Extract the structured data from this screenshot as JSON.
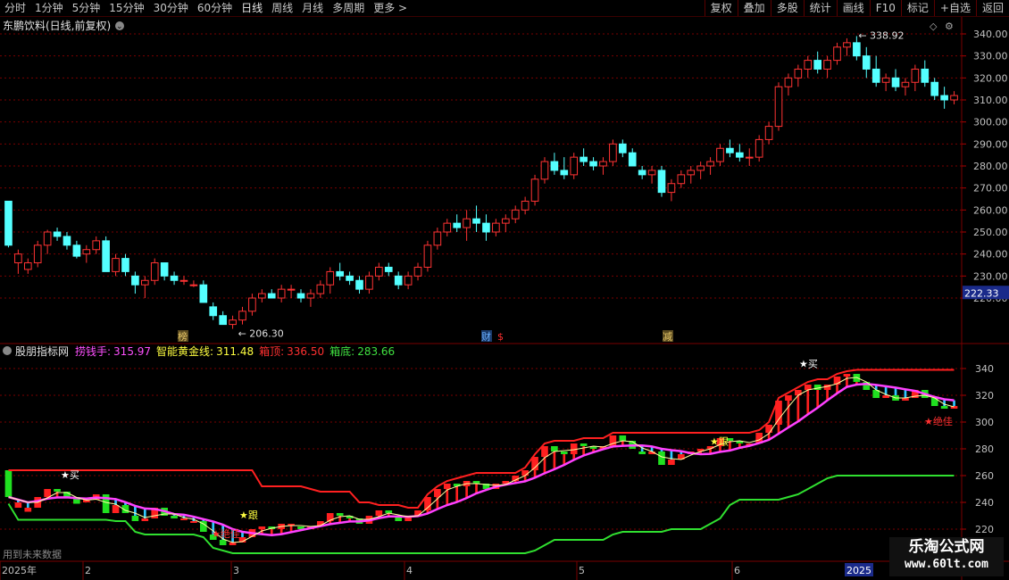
{
  "toolbar": {
    "left": [
      "分时",
      "1分钟",
      "5分钟",
      "15分钟",
      "30分钟",
      "60分钟",
      "日线",
      "周线",
      "月线",
      "多周期",
      "更多 >"
    ],
    "active": "日线",
    "right": [
      "复权",
      "叠加",
      "多股",
      "统计",
      "画线",
      "F10",
      "标记",
      "+自选",
      "返回"
    ]
  },
  "main_panel": {
    "title": "东鹏饮料(日线,前复权)",
    "high_label": "338.92",
    "low_label": "206.30",
    "price_ticks": [
      "340.00",
      "330.00",
      "320.00",
      "310.00",
      "300.00",
      "290.00",
      "280.00",
      "270.00",
      "260.00",
      "250.00",
      "240.00",
      "230.00",
      "220.00"
    ],
    "current_price": "222.33",
    "markers": [
      {
        "text": "榜",
        "color": "#e8c868"
      },
      {
        "text": "财",
        "color": "#6ab0ff"
      },
      {
        "text": "$",
        "color": "#ff3030"
      },
      {
        "text": "减",
        "color": "#e8c868"
      }
    ]
  },
  "indicator_panel": {
    "name": "股朋指标网",
    "legend": [
      {
        "label": "捞钱手:",
        "value": "315.97",
        "color": "#ff50ff"
      },
      {
        "label": "智能黄金线:",
        "value": "311.48",
        "color": "#ffff40"
      },
      {
        "label": "箱顶:",
        "value": "336.50",
        "color": "#ff3030"
      },
      {
        "label": "箱底:",
        "value": "283.66",
        "color": "#40e040"
      }
    ],
    "ticks": [
      "340",
      "320",
      "300",
      "280",
      "260",
      "240",
      "220"
    ],
    "signals": [
      {
        "text": "★买",
        "color": "#ffffff"
      },
      {
        "text": "★跟",
        "color": "#ffff40"
      },
      {
        "text": "★跟",
        "color": "#ffff40"
      },
      {
        "text": "★绝佳",
        "color": "#ff3030"
      },
      {
        "text": "★绝佳",
        "color": "#ff3030"
      },
      {
        "text": "★买",
        "color": "#ffffff"
      }
    ],
    "footer_note": "用到未来数据"
  },
  "date_axis": {
    "labels": [
      "2025年",
      "2",
      "3",
      "4",
      "5",
      "6"
    ],
    "highlight": "2025"
  },
  "watermark": {
    "title": "乐淘公式网",
    "url": "www.60lt.com"
  },
  "colors": {
    "up": "#ff3333",
    "down": "#54ffff",
    "grid": "#7a0000",
    "bg": "#000000",
    "box_top": "#ff2020",
    "box_bottom": "#30e030",
    "line_pink": "#ff40ff"
  },
  "chart_data": {
    "type": "candlestick",
    "title": "东鹏饮料(日线,前复权)",
    "ylim": [
      215,
      345
    ],
    "yticks": [
      220,
      230,
      240,
      250,
      260,
      270,
      280,
      290,
      300,
      310,
      320,
      330,
      340
    ],
    "ohlc": [
      [
        264,
        264,
        243,
        244
      ],
      [
        236,
        242,
        231,
        240
      ],
      [
        233,
        238,
        231,
        236
      ],
      [
        236,
        246,
        234,
        244
      ],
      [
        244,
        251,
        240,
        250
      ],
      [
        250,
        252,
        246,
        248
      ],
      [
        248,
        250,
        242,
        244
      ],
      [
        244,
        246,
        238,
        239
      ],
      [
        240,
        244,
        236,
        242
      ],
      [
        242,
        248,
        240,
        246
      ],
      [
        246,
        248,
        232,
        232
      ],
      [
        232,
        240,
        230,
        238
      ],
      [
        238,
        240,
        230,
        232
      ],
      [
        230,
        232,
        222,
        226
      ],
      [
        226,
        230,
        220,
        228
      ],
      [
        228,
        238,
        226,
        236
      ],
      [
        236,
        236,
        228,
        230
      ],
      [
        230,
        232,
        226,
        228
      ],
      [
        228,
        230,
        226,
        228
      ],
      [
        226,
        228,
        225,
        226
      ],
      [
        226,
        228,
        218,
        218
      ],
      [
        216,
        218,
        210,
        212
      ],
      [
        212,
        214,
        208,
        208
      ],
      [
        208,
        212,
        206,
        210
      ],
      [
        210,
        216,
        208,
        214
      ],
      [
        214,
        222,
        212,
        220
      ],
      [
        220,
        224,
        218,
        222
      ],
      [
        222,
        224,
        220,
        220
      ],
      [
        220,
        226,
        218,
        224
      ],
      [
        224,
        226,
        220,
        224
      ],
      [
        222,
        224,
        218,
        220
      ],
      [
        220,
        224,
        216,
        222
      ],
      [
        222,
        228,
        220,
        226
      ],
      [
        226,
        234,
        222,
        232
      ],
      [
        232,
        236,
        228,
        230
      ],
      [
        230,
        232,
        226,
        228
      ],
      [
        228,
        230,
        222,
        224
      ],
      [
        224,
        232,
        222,
        230
      ],
      [
        230,
        236,
        228,
        234
      ],
      [
        234,
        236,
        230,
        232
      ],
      [
        230,
        232,
        224,
        226
      ],
      [
        226,
        232,
        224,
        230
      ],
      [
        230,
        236,
        228,
        234
      ],
      [
        234,
        246,
        232,
        244
      ],
      [
        244,
        252,
        242,
        250
      ],
      [
        250,
        256,
        248,
        254
      ],
      [
        254,
        258,
        250,
        252
      ],
      [
        252,
        260,
        246,
        256
      ],
      [
        256,
        262,
        250,
        254
      ],
      [
        254,
        258,
        246,
        250
      ],
      [
        250,
        256,
        248,
        254
      ],
      [
        254,
        258,
        250,
        256
      ],
      [
        256,
        262,
        254,
        260
      ],
      [
        260,
        266,
        258,
        264
      ],
      [
        264,
        276,
        262,
        274
      ],
      [
        274,
        284,
        272,
        282
      ],
      [
        282,
        286,
        276,
        278
      ],
      [
        278,
        284,
        274,
        276
      ],
      [
        276,
        286,
        274,
        284
      ],
      [
        284,
        288,
        280,
        282
      ],
      [
        282,
        284,
        278,
        280
      ],
      [
        280,
        284,
        276,
        282
      ],
      [
        282,
        292,
        280,
        290
      ],
      [
        290,
        292,
        284,
        286
      ],
      [
        286,
        288,
        280,
        280
      ],
      [
        278,
        280,
        274,
        276
      ],
      [
        276,
        280,
        272,
        278
      ],
      [
        278,
        280,
        266,
        268
      ],
      [
        268,
        274,
        264,
        272
      ],
      [
        272,
        278,
        270,
        276
      ],
      [
        276,
        280,
        272,
        278
      ],
      [
        278,
        282,
        274,
        280
      ],
      [
        280,
        284,
        276,
        282
      ],
      [
        282,
        290,
        280,
        288
      ],
      [
        288,
        292,
        284,
        286
      ],
      [
        286,
        290,
        282,
        284
      ],
      [
        284,
        288,
        280,
        284
      ],
      [
        284,
        294,
        282,
        292
      ],
      [
        292,
        300,
        290,
        298
      ],
      [
        298,
        318,
        296,
        316
      ],
      [
        316,
        322,
        312,
        320
      ],
      [
        320,
        326,
        316,
        324
      ],
      [
        324,
        330,
        320,
        328
      ],
      [
        328,
        332,
        322,
        324
      ],
      [
        324,
        330,
        320,
        328
      ],
      [
        328,
        336,
        326,
        334
      ],
      [
        334,
        338,
        330,
        336
      ],
      [
        336,
        339,
        328,
        330
      ],
      [
        330,
        334,
        320,
        324
      ],
      [
        324,
        330,
        316,
        318
      ],
      [
        318,
        322,
        314,
        320
      ],
      [
        320,
        324,
        314,
        316
      ],
      [
        316,
        320,
        312,
        318
      ],
      [
        318,
        326,
        314,
        324
      ],
      [
        324,
        328,
        316,
        318
      ],
      [
        318,
        320,
        310,
        312
      ],
      [
        312,
        316,
        306,
        310
      ],
      [
        310,
        314,
        308,
        312
      ]
    ]
  }
}
